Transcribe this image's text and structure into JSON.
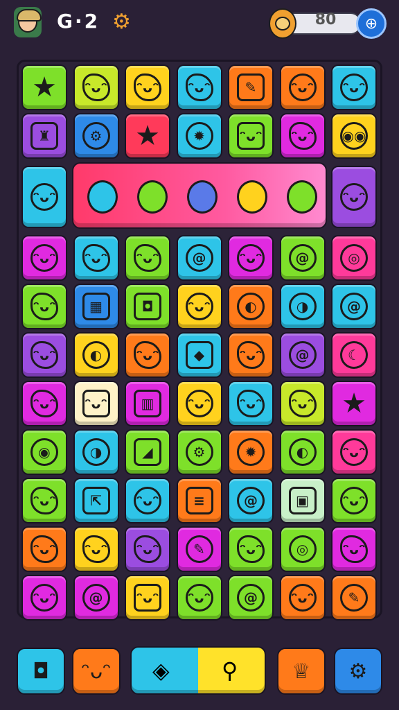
{
  "header": {
    "level_text": "G·2",
    "coins": "80",
    "gear_symbol": "⚙",
    "add_symbol": "⊕"
  },
  "board": {
    "rows": [
      [
        {
          "c": "#7ee02a",
          "s": "★",
          "k": "star",
          "n": "star"
        },
        {
          "c": "#c8e82a",
          "s": "ᵔᴗᵔ",
          "k": "blob",
          "n": "blob-face"
        },
        {
          "c": "#ffd21e",
          "s": "ᵔᴗᵔ",
          "k": "blob",
          "n": "cat-face"
        },
        {
          "c": "#2ec4e8",
          "s": "ᵔᴗᵔ",
          "k": "blob",
          "n": "blob-face"
        },
        {
          "c": "#ff7a1a",
          "s": "✎",
          "k": "sq",
          "n": "note"
        },
        {
          "c": "#ff7a1a",
          "s": "ᵔᴗᵔ",
          "k": "round",
          "n": "smiley"
        },
        {
          "c": "#2ec4e8",
          "s": "ᵔᴗᵔ",
          "k": "round",
          "n": "smiley"
        }
      ],
      [
        {
          "c": "#9b4de0",
          "s": "♜",
          "k": "sq",
          "n": "trophy"
        },
        {
          "c": "#2e8ae8",
          "s": "⚙",
          "k": "round",
          "n": "gear"
        },
        {
          "c": "#ff3a5a",
          "s": "★",
          "k": "star",
          "n": "star"
        },
        {
          "c": "#2ec4e8",
          "s": "✹",
          "k": "round",
          "n": "spiky"
        },
        {
          "c": "#7ee02a",
          "s": "ᵔᴗᵔ",
          "k": "sq",
          "n": "mask"
        },
        {
          "c": "#e02ae0",
          "s": "ᵔᴗᵔ",
          "k": "blob",
          "n": "cloud"
        },
        {
          "c": "#ffd21e",
          "s": "◉◉",
          "k": "round",
          "n": "robot"
        }
      ],
      [
        {
          "c": "#2ec4e8",
          "s": "ᵔᴗᵔ",
          "k": "round",
          "n": "boy"
        },
        null,
        null,
        null,
        null,
        null,
        {
          "c": "#9b4de0",
          "s": "ᵔᴗᵔ",
          "k": "round",
          "n": "hooded"
        }
      ],
      [
        {
          "c": "#e02ae0",
          "s": "ᵔᴗᵔ",
          "k": "round",
          "n": "smiley"
        },
        {
          "c": "#2ec4e8",
          "s": "ᵔᴗᵔ",
          "k": "blob",
          "n": "bubble"
        },
        {
          "c": "#7ee02a",
          "s": "ᵔᴗᵔ",
          "k": "blob",
          "n": "ghost"
        },
        {
          "c": "#2ec4e8",
          "s": "@",
          "k": "round",
          "n": "swirl"
        },
        {
          "c": "#e02ae0",
          "s": "ᵔᴗᵔ",
          "k": "round",
          "n": "moon"
        },
        {
          "c": "#7ee02a",
          "s": "@",
          "k": "round",
          "n": "swirl"
        },
        {
          "c": "#ff3a9a",
          "s": "◎",
          "k": "round",
          "n": "ring"
        }
      ],
      [
        {
          "c": "#7ee02a",
          "s": "ᵔᴗᵔ",
          "k": "blob",
          "n": "sun"
        },
        {
          "c": "#2e8ae8",
          "s": "▦",
          "k": "sq",
          "n": "box"
        },
        {
          "c": "#7ee02a",
          "s": "◘",
          "k": "sq",
          "n": "house"
        },
        {
          "c": "#ffd21e",
          "s": "ᵔᴗᵔ",
          "k": "round",
          "n": "smiley"
        },
        {
          "c": "#ff7a1a",
          "s": "◐",
          "k": "round",
          "n": "ring"
        },
        {
          "c": "#2ec4e8",
          "s": "◑",
          "k": "round",
          "n": "orb"
        },
        {
          "c": "#2ec4e8",
          "s": "@",
          "k": "round",
          "n": "swirl"
        }
      ],
      [
        {
          "c": "#9b4de0",
          "s": "ᵔᴗᵔ",
          "k": "blob",
          "n": "monster"
        },
        {
          "c": "#ffd21e",
          "s": "◐",
          "k": "round",
          "n": "orb"
        },
        {
          "c": "#ff7a1a",
          "s": "ᵔᴗᵔ",
          "k": "blob",
          "n": "blob"
        },
        {
          "c": "#2ec4e8",
          "s": "◆",
          "k": "sq",
          "n": "candy"
        },
        {
          "c": "#ff7a1a",
          "s": "ᵔᴗᵔ",
          "k": "blob",
          "n": "cat"
        },
        {
          "c": "#9b4de0",
          "s": "@",
          "k": "round",
          "n": "swirl"
        },
        {
          "c": "#ff3a9a",
          "s": "☾",
          "k": "round",
          "n": "moon"
        }
      ],
      [
        {
          "c": "#e02ae0",
          "s": "ᵔᴗᵔ",
          "k": "blob",
          "n": "flower"
        },
        {
          "c": "#fff2c8",
          "s": "ᵔᴗᵔ",
          "k": "sq",
          "n": "bear"
        },
        {
          "c": "#e02ae0",
          "s": "▥",
          "k": "sq",
          "n": "bin"
        },
        {
          "c": "#ffd21e",
          "s": "ᵔᴗᵔ",
          "k": "round",
          "n": "face"
        },
        {
          "c": "#2ec4e8",
          "s": "ᵔᴗᵔ",
          "k": "blob",
          "n": "frog"
        },
        {
          "c": "#c8e82a",
          "s": "ᵔᴗᵔ",
          "k": "blob",
          "n": "leaf"
        },
        {
          "c": "#e02ae0",
          "s": "★",
          "k": "star",
          "n": "star"
        }
      ],
      [
        {
          "c": "#7ee02a",
          "s": "◉",
          "k": "round",
          "n": "eye"
        },
        {
          "c": "#2ec4e8",
          "s": "◑",
          "k": "round",
          "n": "orb"
        },
        {
          "c": "#7ee02a",
          "s": "◢",
          "k": "sq",
          "n": "ruler"
        },
        {
          "c": "#7ee02a",
          "s": "⚙",
          "k": "round",
          "n": "gear"
        },
        {
          "c": "#ff7a1a",
          "s": "✹",
          "k": "round",
          "n": "burst"
        },
        {
          "c": "#7ee02a",
          "s": "◐",
          "k": "round",
          "n": "orb"
        },
        {
          "c": "#ff3a9a",
          "s": "ᵔᴗᵔ",
          "k": "round",
          "n": "bird"
        }
      ],
      [
        {
          "c": "#7ee02a",
          "s": "ᵔᴗᵔ",
          "k": "blob",
          "n": "cloud"
        },
        {
          "c": "#2ec4e8",
          "s": "⇱",
          "k": "sq",
          "n": "frame"
        },
        {
          "c": "#2ec4e8",
          "s": "ᵔᴗᵔ",
          "k": "round",
          "n": "smiley"
        },
        {
          "c": "#ff7a1a",
          "s": "≡",
          "k": "sq",
          "n": "stack"
        },
        {
          "c": "#2ec4e8",
          "s": "@",
          "k": "round",
          "n": "swirl"
        },
        {
          "c": "#c8f0c8",
          "s": "▣",
          "k": "sq",
          "n": "radio"
        },
        {
          "c": "#7ee02a",
          "s": "ᵔᴗᵔ",
          "k": "round",
          "n": "bubble"
        }
      ],
      [
        {
          "c": "#ff7a1a",
          "s": "ᵔᴗᵔ",
          "k": "blob",
          "n": "spiky"
        },
        {
          "c": "#ffd21e",
          "s": "ᵔᴗᵔ",
          "k": "blob",
          "n": "sun"
        },
        {
          "c": "#9b4de0",
          "s": "ᵔᴗᵔ",
          "k": "blob",
          "n": "shield"
        },
        {
          "c": "#e02ae0",
          "s": "✎",
          "k": "round",
          "n": "carrot"
        },
        {
          "c": "#7ee02a",
          "s": "ᵔᴗᵔ",
          "k": "blob",
          "n": "dragon"
        },
        {
          "c": "#7ee02a",
          "s": "◎",
          "k": "round",
          "n": "donut"
        },
        {
          "c": "#e02ae0",
          "s": "ᵔᴗᵔ",
          "k": "blob",
          "n": "ghost"
        }
      ],
      [
        {
          "c": "#e02ae0",
          "s": "ᵔᴗᵔ",
          "k": "round",
          "n": "smiley"
        },
        {
          "c": "#e02ae0",
          "s": "@",
          "k": "round",
          "n": "spiral"
        },
        {
          "c": "#ffd21e",
          "s": "ᵔᴗᵔ",
          "k": "sq",
          "n": "robot"
        },
        {
          "c": "#7ee02a",
          "s": "ᵔᴗᵔ",
          "k": "round",
          "n": "smiley"
        },
        {
          "c": "#7ee02a",
          "s": "@",
          "k": "round",
          "n": "lollipop"
        },
        {
          "c": "#ff7a1a",
          "s": "ᵔᴗᵔ",
          "k": "round",
          "n": "bubble"
        },
        {
          "c": "#ff7a1a",
          "s": "✎",
          "k": "round",
          "n": "leaf"
        }
      ]
    ]
  },
  "banner": {
    "characters": [
      {
        "c": "#2ec4e8",
        "n": "brush"
      },
      {
        "c": "#7ee02a",
        "n": "wizard"
      },
      {
        "c": "#5a7ae8",
        "n": "elephant"
      },
      {
        "c": "#ffd21e",
        "n": "girl"
      },
      {
        "c": "#7ee02a",
        "n": "sprout"
      }
    ]
  },
  "toolbar": {
    "buttons": [
      {
        "c": "#2ec4e8",
        "s": "◘",
        "n": "puzzle"
      },
      {
        "c": "#ff7a1a",
        "s": "ᵔᴗᵔ",
        "n": "cloud-face"
      },
      {
        "c": "#ff7a1a",
        "s": "♕",
        "n": "cupcake"
      },
      {
        "c": "#2e8ae8",
        "s": "⚙",
        "n": "settings"
      }
    ],
    "wide_left_symbol": "◈",
    "wide_right_symbol": "⚲"
  }
}
